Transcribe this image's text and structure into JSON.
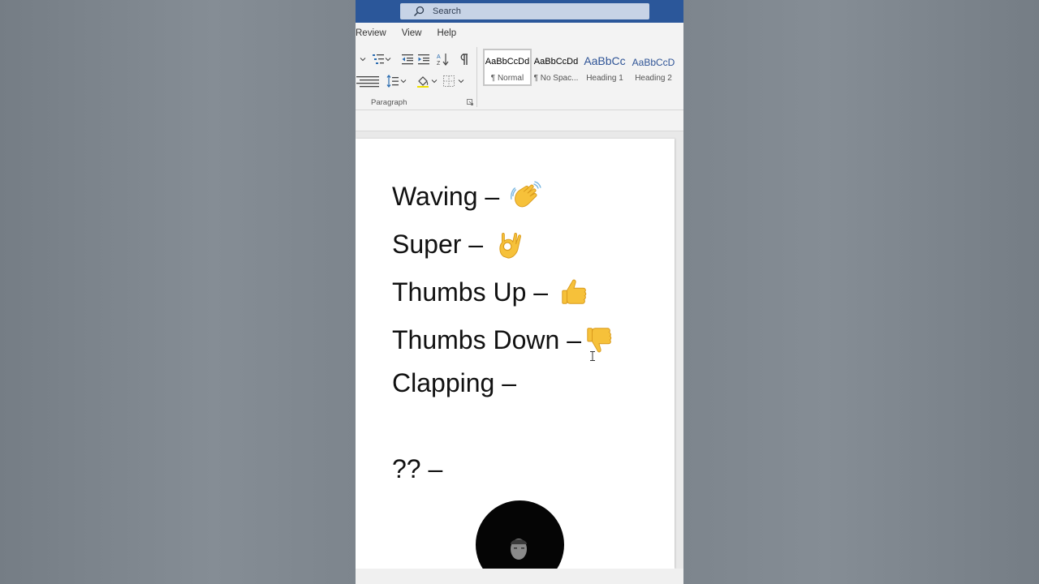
{
  "search": {
    "placeholder": "Search",
    "icon": "search-icon"
  },
  "menu_tabs": [
    "Review",
    "View",
    "Help"
  ],
  "ribbon": {
    "paragraph_group_label": "Paragraph",
    "styles": [
      {
        "sample": "AaBbCcDd",
        "name": "¶ Normal",
        "selected": true
      },
      {
        "sample": "AaBbCcDd",
        "name": "¶ No Spac...",
        "selected": false
      },
      {
        "sample": "AaBbCc",
        "name": "Heading 1",
        "selected": false
      },
      {
        "sample": "AaBbCcD",
        "name": "Heading 2",
        "selected": false
      }
    ]
  },
  "document": {
    "lines": [
      {
        "text": "Waving –",
        "emoji": "waving-hand-icon"
      },
      {
        "text": "Super –",
        "emoji": "ok-hand-icon"
      },
      {
        "text": "Thumbs Up –",
        "emoji": "thumbs-up-icon"
      },
      {
        "text": "Thumbs Down –",
        "emoji": "thumbs-down-icon"
      },
      {
        "text": "Clapping –",
        "emoji": ""
      },
      {
        "text": "?? –",
        "emoji": ""
      }
    ]
  },
  "colors": {
    "titlebar": "#2b579a",
    "heading_style": "#2f5496",
    "emoji_yellow": "#f6c13a"
  }
}
